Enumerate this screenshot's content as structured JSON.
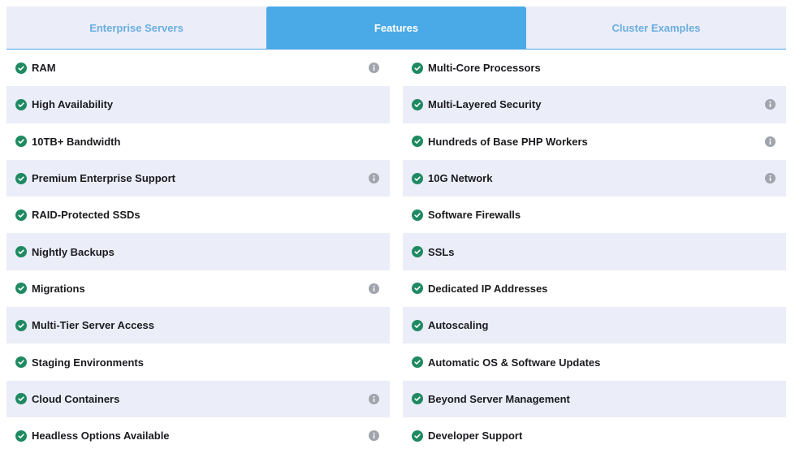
{
  "tabs": [
    {
      "label": "Enterprise Servers",
      "active": false
    },
    {
      "label": "Features",
      "active": true
    },
    {
      "label": "Cluster Examples",
      "active": false
    }
  ],
  "colors": {
    "active_tab": "#4aa9e7",
    "inactive_tab_text": "#6aaee0",
    "row_shade": "#ebedf8",
    "check": "#1f8a62",
    "info": "#a1a3ad"
  },
  "features_left": [
    {
      "label": "RAM",
      "icon": "check-circle-icon",
      "info": true
    },
    {
      "label": "High Availability",
      "icon": "check-circle-icon",
      "info": false
    },
    {
      "label": "10TB+ Bandwidth",
      "icon": "check-circle-icon",
      "info": false
    },
    {
      "label": "Premium Enterprise Support",
      "icon": "check-circle-icon",
      "info": true
    },
    {
      "label": "RAID-Protected SSDs",
      "icon": "check-circle-icon",
      "info": false
    },
    {
      "label": "Nightly Backups",
      "icon": "check-circle-icon",
      "info": false
    },
    {
      "label": "Migrations",
      "icon": "check-circle-icon",
      "info": true
    },
    {
      "label": "Multi-Tier Server Access",
      "icon": "check-circle-icon",
      "info": false
    },
    {
      "label": "Staging Environments",
      "icon": "check-circle-icon",
      "info": false
    },
    {
      "label": "Cloud Containers",
      "icon": "check-circle-icon",
      "info": true
    },
    {
      "label": "Headless Options Available",
      "icon": "check-circle-icon",
      "info": true
    }
  ],
  "features_right": [
    {
      "label": "Multi-Core Processors",
      "icon": "check-circle-icon",
      "info": false
    },
    {
      "label": "Multi-Layered Security",
      "icon": "check-circle-icon",
      "info": true
    },
    {
      "label": "Hundreds of Base PHP Workers",
      "icon": "check-circle-icon",
      "info": true
    },
    {
      "label": "10G Network",
      "icon": "check-circle-icon",
      "info": true
    },
    {
      "label": "Software Firewalls",
      "icon": "check-circle-icon",
      "info": false
    },
    {
      "label": "SSLs",
      "icon": "check-circle-icon",
      "info": false
    },
    {
      "label": "Dedicated IP Addresses",
      "icon": "check-circle-icon",
      "info": false
    },
    {
      "label": "Autoscaling",
      "icon": "check-circle-icon",
      "info": false
    },
    {
      "label": "Automatic OS & Software Updates",
      "icon": "check-circle-icon",
      "info": false
    },
    {
      "label": "Beyond Server Management",
      "icon": "check-circle-icon",
      "info": false
    },
    {
      "label": "Developer Support",
      "icon": "check-circle-icon",
      "info": false
    }
  ]
}
